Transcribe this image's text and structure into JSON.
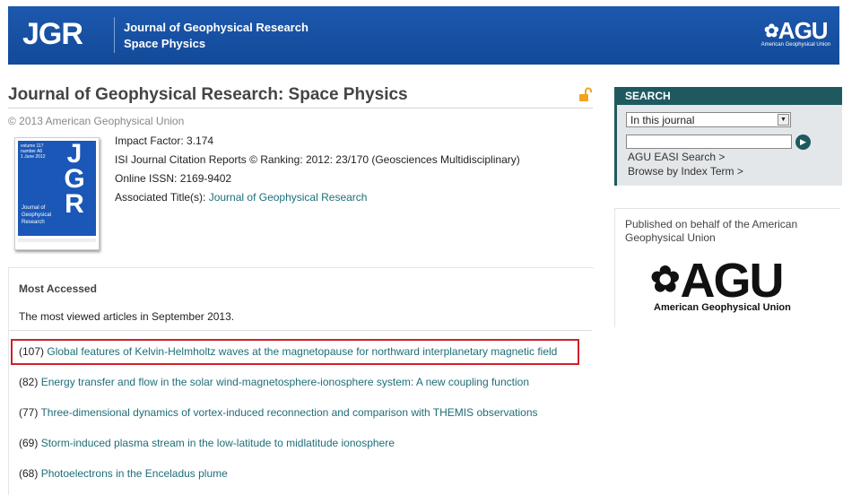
{
  "header": {
    "logo": "JGR",
    "title_line1": "Journal of Geophysical Research",
    "title_line2": "Space Physics",
    "agu_logo": "AGU",
    "agu_tagline": "American Geophysical Union"
  },
  "journal": {
    "title": "Journal of Geophysical Research: Space Physics",
    "copyright": "© 2013 American Geophysical Union",
    "cover": {
      "letters": "JGR",
      "meta": "volume 117\nnumber A6\n1 June 2012",
      "name": "Journal of\nGeophysical\nResearch"
    },
    "impact_factor": "Impact Factor: 3.174",
    "ranking": "ISI Journal Citation Reports © Ranking: 2012: 23/170 (Geosciences Multidisciplinary)",
    "issn": "Online ISSN: 2169-9402",
    "associated_label": "Associated Title(s): ",
    "associated_link": "Journal of Geophysical Research"
  },
  "most_accessed": {
    "heading": "Most Accessed",
    "subtitle": "The most viewed articles in September 2013.",
    "articles": [
      {
        "count": "(107) ",
        "title": "Global features of Kelvin-Helmholtz waves at the magnetopause for northward interplanetary magnetic field"
      },
      {
        "count": "(82) ",
        "title": "Energy transfer and flow in the solar wind-magnetosphere-ionosphere system: A new coupling function"
      },
      {
        "count": "(77) ",
        "title": "Three-dimensional dynamics of vortex-induced reconnection and comparison with THEMIS observations"
      },
      {
        "count": "(69) ",
        "title": "Storm-induced plasma stream in the low-latitude to midlatitude ionosphere"
      },
      {
        "count": "(68) ",
        "title": "Photoelectrons in the Enceladus plume"
      }
    ]
  },
  "search": {
    "heading": "SEARCH",
    "scope_selected": "In this journal",
    "input_value": "",
    "link_easi": "AGU EASI Search >",
    "link_index": "Browse by Index Term >"
  },
  "publisher": {
    "text": "Published on behalf of the American Geophysical Union",
    "logo": "AGU",
    "logo_sub": "American Geophysical Union"
  },
  "colors": {
    "banner": "#1a55a8",
    "link": "#1d6e78",
    "sidebar_accent": "#1f5960",
    "highlight": "#d0202a"
  }
}
